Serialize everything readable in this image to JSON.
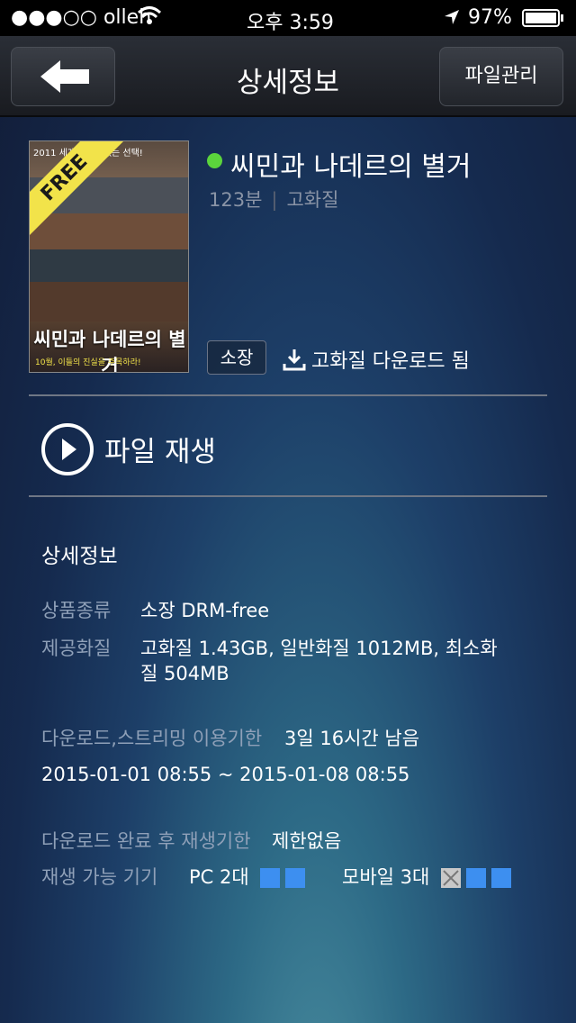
{
  "status_bar": {
    "signal": "●●●○○ olleh",
    "time": "오후 3:59",
    "battery": "97%"
  },
  "nav": {
    "title": "상세정보",
    "file_manage": "파일관리"
  },
  "poster": {
    "badge": "FREE",
    "title": "씨민과 나데르의 별거",
    "top_text": "2011 세계의 유례없는 선택!",
    "tagline": "10월, 이들의 진실을 주목하라!"
  },
  "movie": {
    "title": "씨민과 나데르의 별거",
    "runtime": "123분",
    "quality": "고화질",
    "own_badge": "소장",
    "download_status": "고화질 다운로드 됨"
  },
  "play": {
    "label": "파일 재생"
  },
  "details": {
    "title": "상세정보",
    "product_type_label": "상품종류",
    "product_type_value": "소장 DRM-free",
    "quality_label": "제공화질",
    "quality_value_line1": "고화질 1.43GB, 일반화질 1012MB, 최소화",
    "quality_value_line2": "질 504MB",
    "period_label": "다운로드,스트리밍 이용기한",
    "period_remaining": "3일 16시간 남음",
    "period_range": "2015-01-01 08:55 ~ 2015-01-08 08:55",
    "after_dl_label": "다운로드 완료 후 재생기한",
    "after_dl_value": "제한없음",
    "devices_label": "재생 가능 기기",
    "pc_label": "PC 2대",
    "mobile_label": "모바일 3대"
  },
  "colors": {
    "accent_blue": "#3d8ff0",
    "online_green": "#5bd43c"
  }
}
